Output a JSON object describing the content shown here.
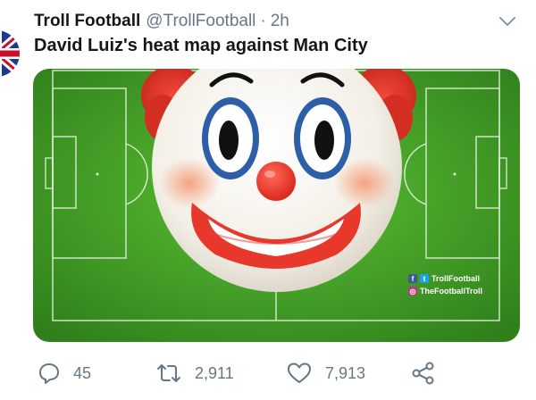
{
  "tweet": {
    "author_name": "Troll Football",
    "author_handle": "@TrollFootball",
    "separator": "·",
    "time": "2h",
    "text": "David Luiz's heat map against Man City"
  },
  "media": {
    "watermark": {
      "line1": "TrollFootball",
      "line2": "TheFootballTroll"
    }
  },
  "actions": {
    "reply_count": "45",
    "retweet_count": "2,911",
    "like_count": "7,913"
  },
  "icons": {
    "avatar": "union-jack-avatar",
    "more": "chevron-down-icon",
    "reply": "reply-icon",
    "retweet": "retweet-icon",
    "like": "heart-icon",
    "share": "share-icon"
  },
  "colors": {
    "name": "#14171a",
    "secondary": "#657786",
    "pitch_green": "#3f9a24",
    "clown_red": "#e8372b",
    "clown_blue": "#2d5ea8"
  }
}
